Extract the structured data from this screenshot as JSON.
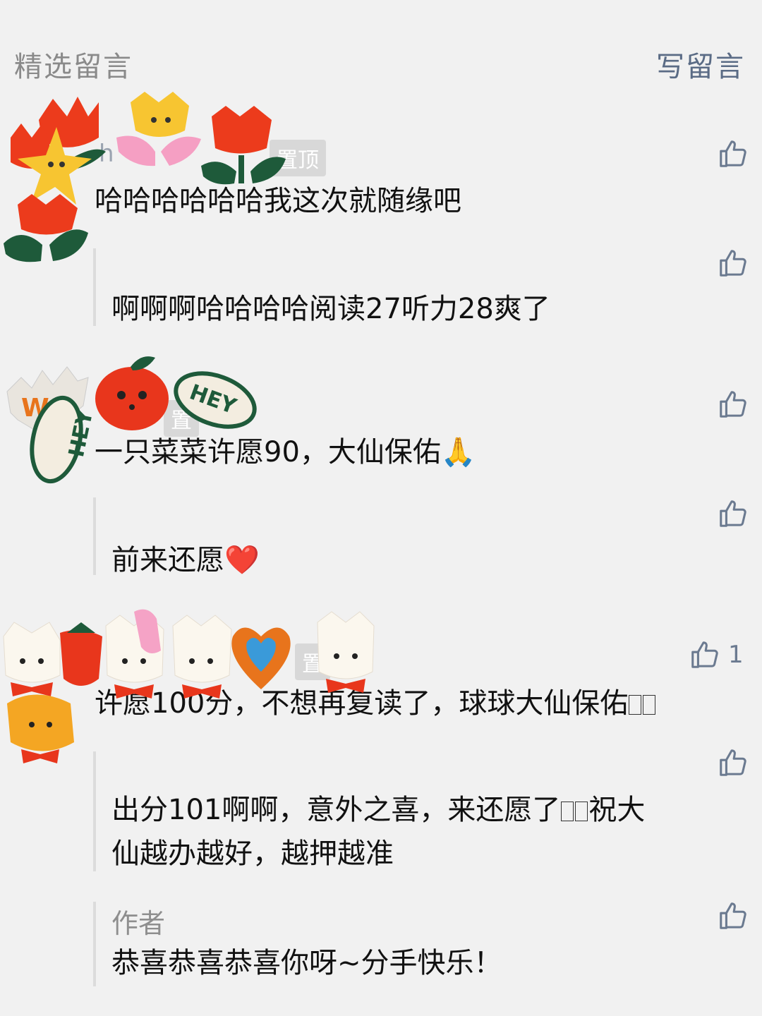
{
  "header": {
    "title": "精选留言",
    "write_label": "写留言"
  },
  "comments": [
    {
      "name": "h",
      "pin_label": "置顶",
      "text": "哈哈哈哈哈哈我这次就随缘吧",
      "reply": "啊啊啊哈哈哈哈阅读27听力28爽了"
    },
    {
      "pin_label": "置",
      "text": "一只菜菜许愿90，大仙保佑🙏",
      "reply": "前来还愿❤️"
    },
    {
      "pin_label": "置",
      "text": "许愿100分，不想再复读了，球球大仙保佑",
      "like_count": "1",
      "reply_line1": "出分101啊啊，意外之喜，来还愿了",
      "reply_line1_end": "祝大",
      "reply_line2": "仙越办越好，越押越准"
    }
  ],
  "author_reply": {
    "label": "作者",
    "text": "恭喜恭喜恭喜你呀~分手快乐！"
  },
  "icons": {
    "like": "thumbs-up-icon",
    "sticker_tulips": "tulip-stickers",
    "sticker_hey": "hey-stickers",
    "sticker_puppies": "puppy-stickers"
  },
  "colors": {
    "background": "#f1f1f1",
    "link": "#5a6b85",
    "muted": "#8a8a8a"
  }
}
